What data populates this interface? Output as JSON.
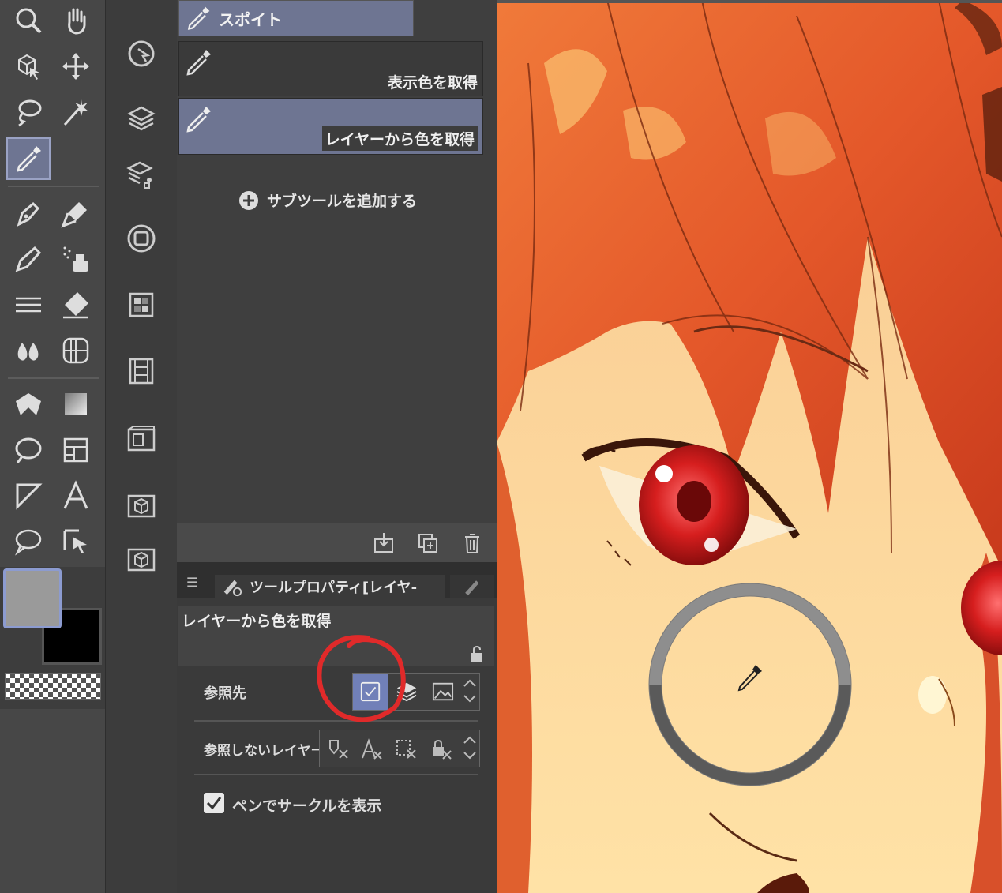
{
  "subtool_panel": {
    "header_label": "スポイト",
    "items": [
      {
        "label": "表示色を取得",
        "selected": false
      },
      {
        "label": "レイヤーから色を取得",
        "selected": true
      }
    ],
    "add_subtool_label": "サブツールを追加する"
  },
  "tool_property": {
    "tab_label": "ツールプロパティ[レイヤ-",
    "title": "レイヤーから色を取得",
    "reference_label": "参照先",
    "exclude_label": "参照しないレイヤー",
    "show_circle_label": "ペンでサークルを表示",
    "show_circle_checked": true
  },
  "colors": {
    "main_color": "#9a9a9a",
    "sub_color": "#000000",
    "accent": "#6e7592",
    "annotation_red": "#e02a2a"
  }
}
